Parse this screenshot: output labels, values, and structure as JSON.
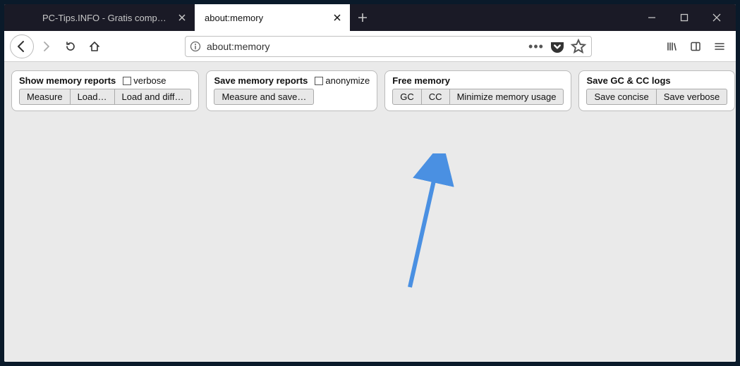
{
  "window": {
    "tabs": [
      {
        "title": "PC-Tips.INFO - Gratis computer tips",
        "active": false
      },
      {
        "title": "about:memory",
        "active": true
      }
    ]
  },
  "nav": {
    "url": "about:memory"
  },
  "panels": {
    "show": {
      "title": "Show memory reports",
      "checkbox": "verbose",
      "buttons": [
        "Measure",
        "Load…",
        "Load and diff…"
      ]
    },
    "save": {
      "title": "Save memory reports",
      "checkbox": "anonymize",
      "buttons": [
        "Measure and save…"
      ]
    },
    "free": {
      "title": "Free memory",
      "buttons": [
        "GC",
        "CC",
        "Minimize memory usage"
      ]
    },
    "logs": {
      "title": "Save GC & CC logs",
      "buttons": [
        "Save concise",
        "Save verbose"
      ]
    }
  }
}
